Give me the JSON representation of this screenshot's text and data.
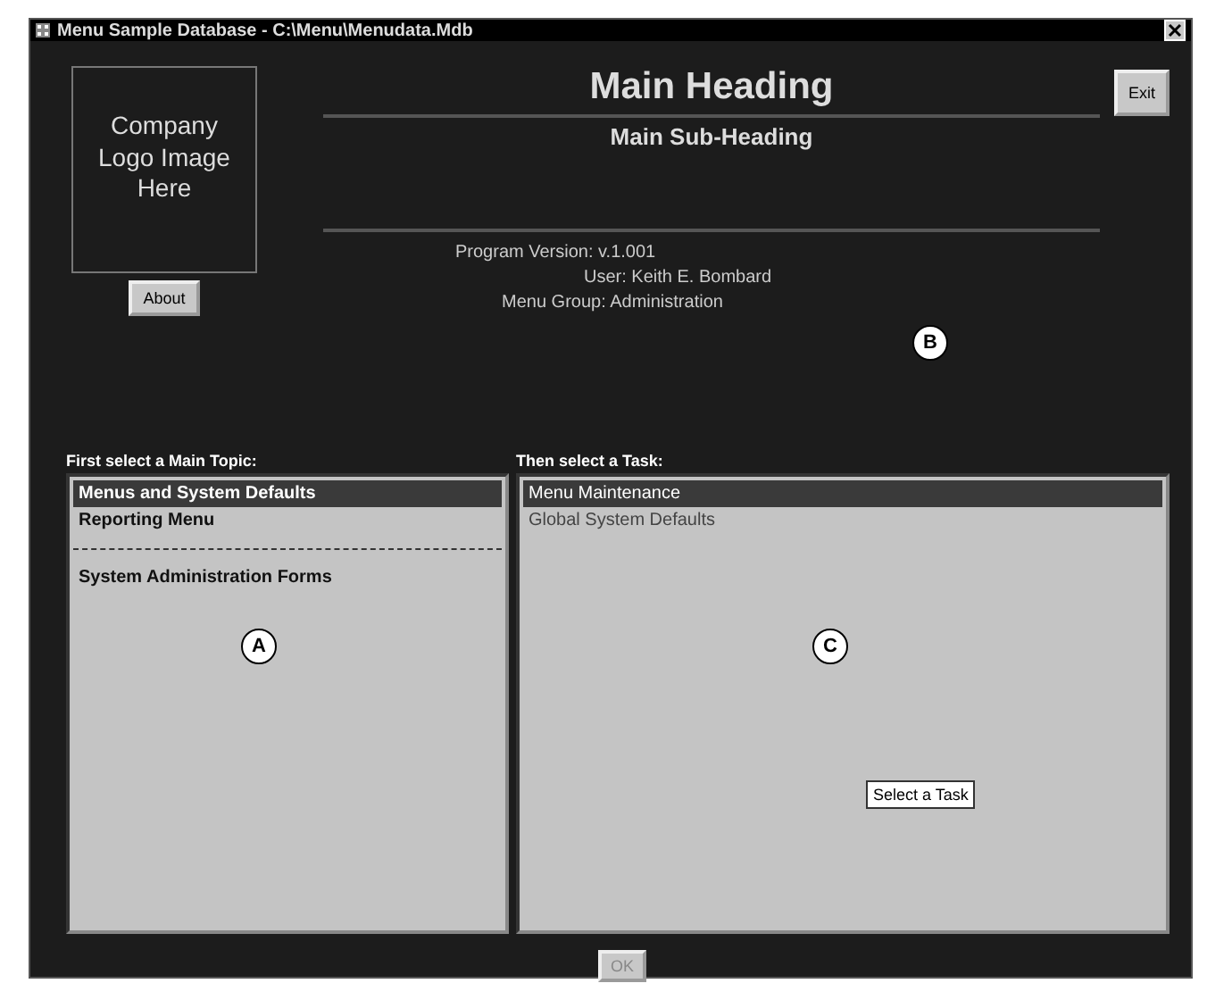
{
  "window": {
    "title": "Menu Sample Database - C:\\Menu\\Menudata.Mdb"
  },
  "logo": {
    "text": "Company Logo Image Here"
  },
  "about_button": {
    "label": "About"
  },
  "exit_button": {
    "label": "Exit"
  },
  "heading": "Main Heading",
  "sub_heading": "Main Sub-Heading",
  "info": [
    {
      "text": "Program Version: v.1.001"
    },
    {
      "text": "User: Keith E. Bombard"
    },
    {
      "text": "Menu Group: Administration"
    }
  ],
  "topics": {
    "label": "First select a Main Topic:",
    "items": [
      {
        "kind": "item",
        "label": "Menus and System Defaults",
        "selected": true
      },
      {
        "kind": "item",
        "label": "Reporting Menu",
        "selected": false
      },
      {
        "kind": "separator"
      },
      {
        "kind": "item",
        "label": "System Administration Forms",
        "selected": false
      }
    ]
  },
  "tasks": {
    "label": "Then select a Task:",
    "items": [
      {
        "label": "Menu Maintenance",
        "selected": true
      },
      {
        "label": "Global System Defaults",
        "selected": false
      }
    ]
  },
  "tooltip": "Select a Task",
  "ok_button": {
    "label": "OK",
    "disabled": true
  },
  "callouts": [
    {
      "text": "A"
    },
    {
      "text": "B"
    },
    {
      "text": "C"
    }
  ]
}
